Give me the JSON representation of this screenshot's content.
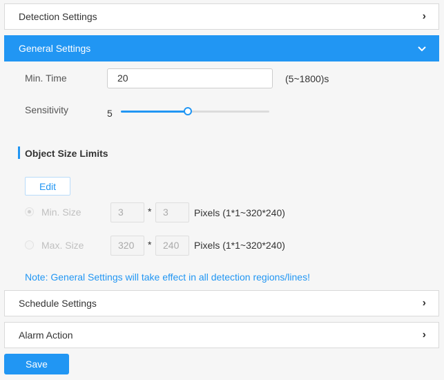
{
  "panels": {
    "detection": {
      "label": "Detection Settings",
      "chevron": "›"
    },
    "general": {
      "label": "General Settings",
      "chevron": "⌄"
    },
    "schedule": {
      "label": "Schedule Settings",
      "chevron": "›"
    },
    "alarm": {
      "label": "Alarm Action",
      "chevron": "›"
    }
  },
  "general": {
    "min_time": {
      "label": "Min. Time",
      "value": "20",
      "range": "(5~1800)s"
    },
    "sensitivity": {
      "label": "Sensitivity",
      "value": "5",
      "level_fraction": 0.45
    },
    "object_size": {
      "title": "Object Size Limits",
      "edit_label": "Edit",
      "min_size": {
        "label": "Min. Size",
        "w": "3",
        "h": "3",
        "sep": "*",
        "unit": "Pixels (1*1~320*240)",
        "selected": true
      },
      "max_size": {
        "label": "Max. Size",
        "w": "320",
        "h": "240",
        "sep": "*",
        "unit": "Pixels (1*1~320*240)",
        "selected": false
      }
    },
    "note": "Note: General Settings will take effect in all detection regions/lines!"
  },
  "save_label": "Save",
  "colors": {
    "accent": "#2196f3",
    "background": "#f6f6f6"
  }
}
